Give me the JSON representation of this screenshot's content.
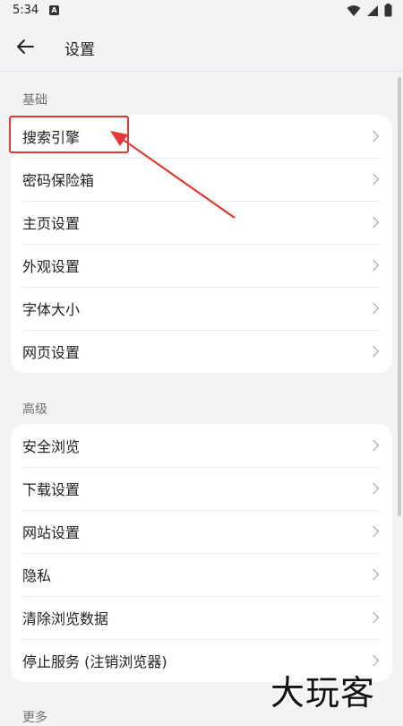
{
  "status_bar": {
    "time": "5:34",
    "notification_icon_letter": "A"
  },
  "header": {
    "title": "设置"
  },
  "sections": [
    {
      "label": "基础",
      "items": [
        {
          "label": "搜索引擎"
        },
        {
          "label": "密码保险箱"
        },
        {
          "label": "主页设置"
        },
        {
          "label": "外观设置"
        },
        {
          "label": "字体大小"
        },
        {
          "label": "网页设置"
        }
      ]
    },
    {
      "label": "高级",
      "items": [
        {
          "label": "安全浏览"
        },
        {
          "label": "下载设置"
        },
        {
          "label": "网站设置"
        },
        {
          "label": "隐私"
        },
        {
          "label": "清除浏览数据"
        },
        {
          "label": "停止服务 (注销浏览器)"
        }
      ]
    },
    {
      "label": "更多",
      "items": []
    }
  ],
  "watermark": "大玩客",
  "colors": {
    "background": "#f1f3f5",
    "card": "#ffffff",
    "annotation_red": "#e53935"
  }
}
